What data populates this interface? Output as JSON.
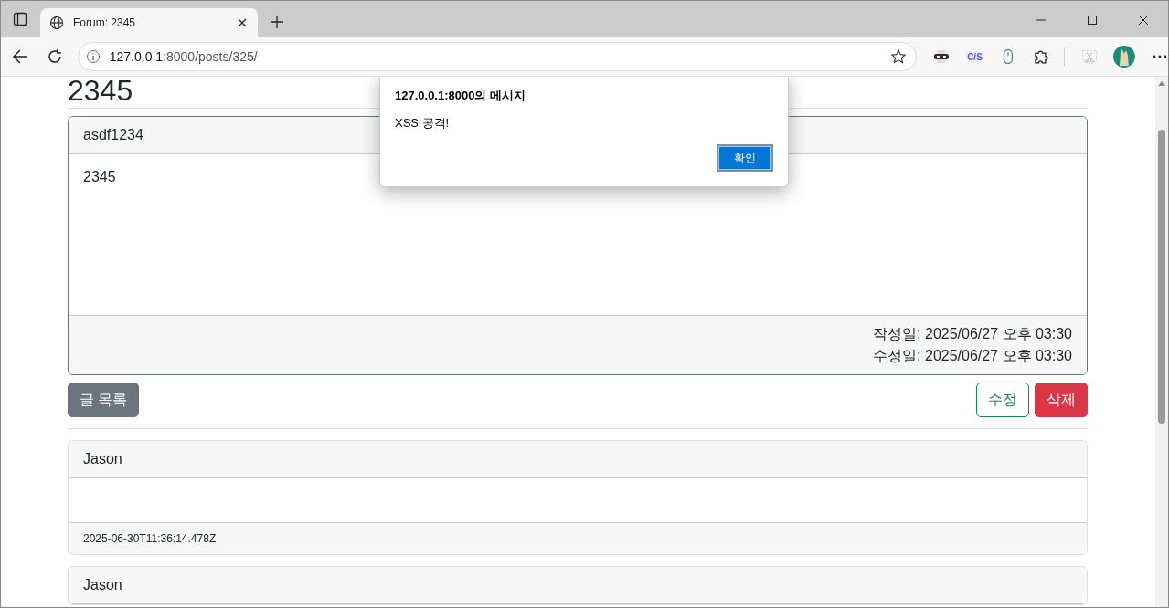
{
  "browser": {
    "tabs": [
      {
        "title": "Forum: 2345",
        "selected": true
      }
    ],
    "address": {
      "host": "127.0.0.1",
      "path": ":8000/posts/325/"
    },
    "extension_badge": "C/S"
  },
  "post": {
    "title": "2345",
    "author": "asdf1234",
    "body": "2345",
    "dates": [
      "작성일: 2025/06/27 오후 03:30",
      "수정일: 2025/06/27 오후 03:30"
    ]
  },
  "actions": [
    {
      "kind": "list",
      "label": "글 목록"
    },
    {
      "kind": "edit",
      "label": "수정"
    },
    {
      "kind": "delete",
      "label": "삭제"
    }
  ],
  "comments": [
    {
      "author": "Jason",
      "timestamp": "2025-06-30T11:36:14.478Z"
    },
    {
      "author": "Jason"
    }
  ],
  "dialog": {
    "title": "127.0.0.1:8000의 메시지",
    "message": "XSS 공격!",
    "button": "확인"
  }
}
